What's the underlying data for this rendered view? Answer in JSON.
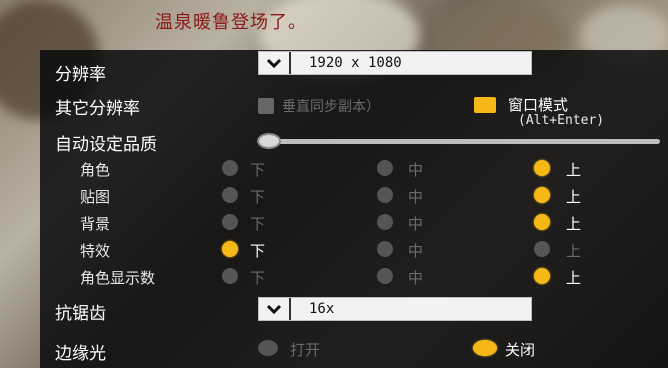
{
  "background": {
    "title_text": "温泉暖鲁登场了。"
  },
  "resolution": {
    "label": "分辨率",
    "value": "1920 x 1080"
  },
  "other_resolution": {
    "label": "其它分辨率",
    "faded_text": "垂直同步副本）"
  },
  "window_mode": {
    "label": "窗口模式",
    "shortcut": "(Alt+Enter)",
    "checked": true
  },
  "auto_quality": {
    "label": "自动设定品质",
    "level": 0
  },
  "quality_rows": [
    {
      "label": "角色",
      "selected": "上"
    },
    {
      "label": "贴图",
      "selected": "上"
    },
    {
      "label": "背景",
      "selected": "上"
    },
    {
      "label": "特效",
      "selected": "下"
    },
    {
      "label": "角色显示数",
      "selected": "上"
    }
  ],
  "quality_options": {
    "low": "下",
    "mid": "中",
    "high": "上"
  },
  "antialias": {
    "label": "抗锯齿",
    "value": "16x"
  },
  "edge_light": {
    "label": "边缘光",
    "on_label": "打开",
    "off_label": "关闭",
    "selected": "关闭"
  },
  "colors": {
    "accent": "#f5b817",
    "panel": "#0a0a0c"
  }
}
